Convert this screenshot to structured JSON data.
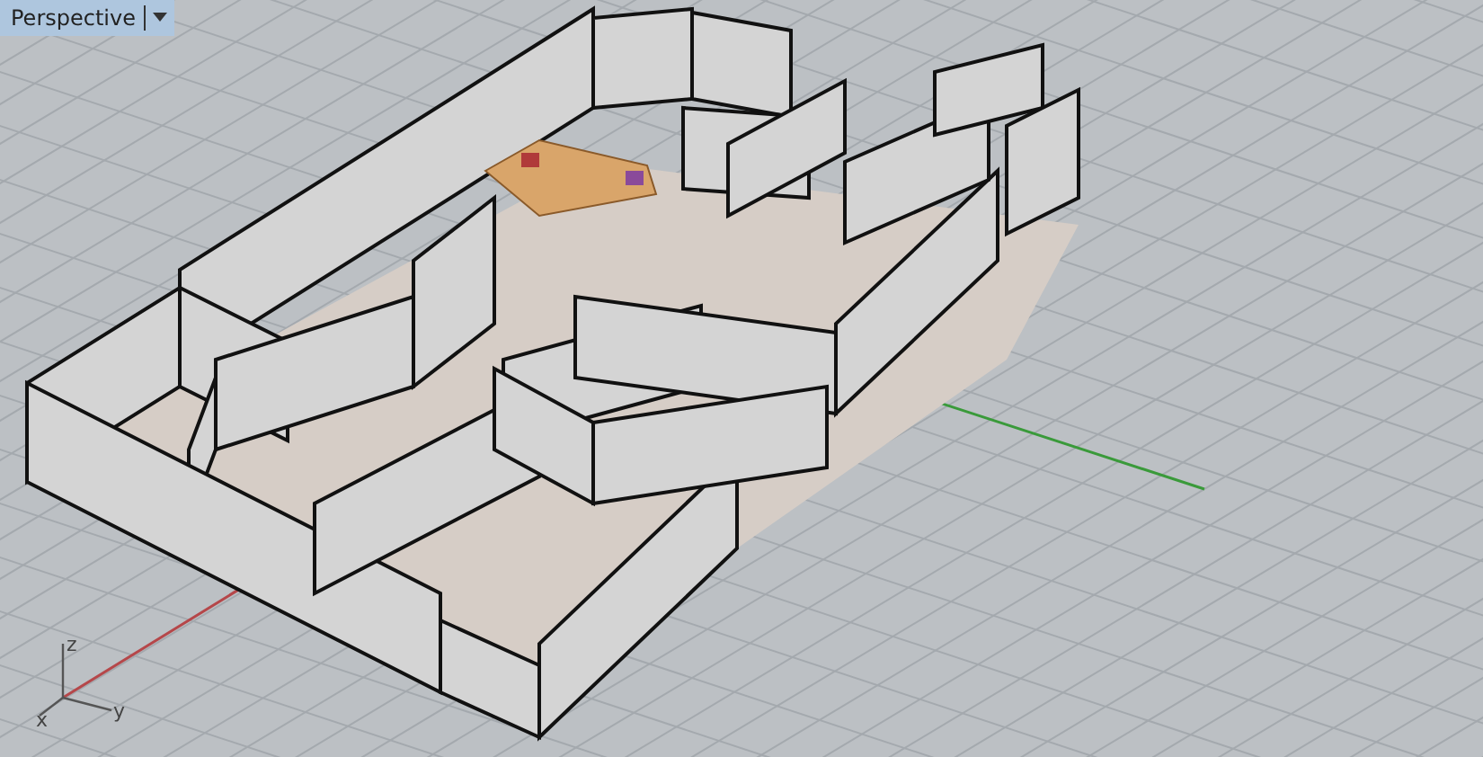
{
  "viewport": {
    "title": "Perspective",
    "axes": {
      "z": "z",
      "x": "x",
      "y": "y"
    }
  }
}
